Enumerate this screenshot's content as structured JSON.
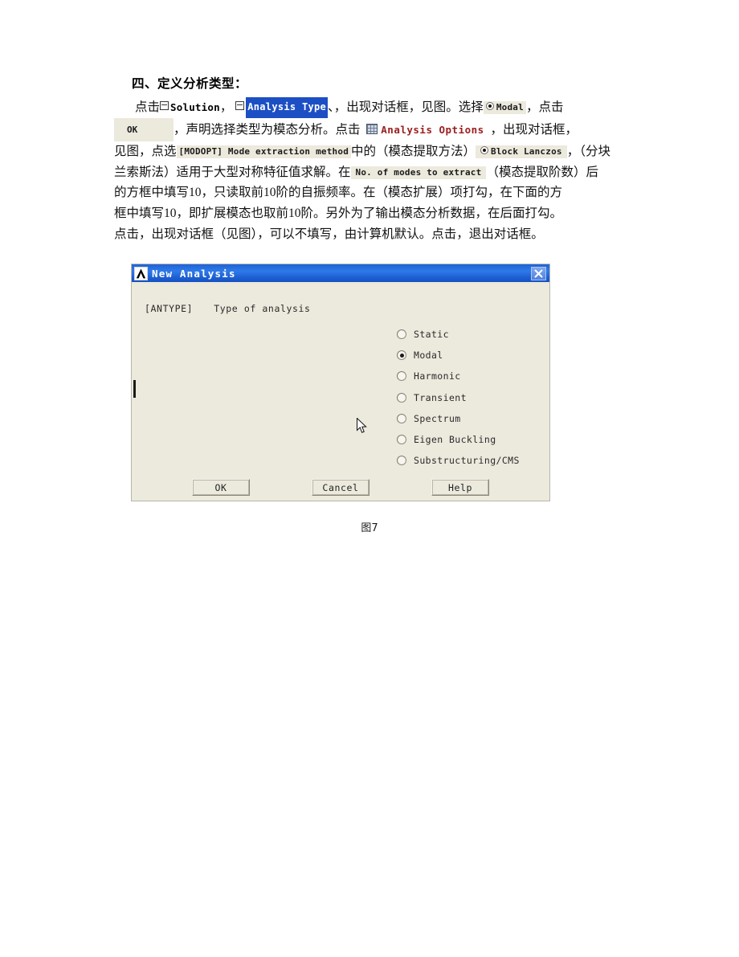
{
  "document": {
    "heading": "四、定义分析类型：",
    "paragraph_lines": [
      "点击⊟ Solution ， ⊟ Analysis Type 、，出现对话框，见图。选择⦿ Modal ，点击",
      "OK ，声明选择类型为模态分析。点击 ▦ Analysis Options ，出现对话框，",
      "见图，点选[MODOPT] Mode extraction method中的（模态提取方法）⦿ Block Lanczos ，（分块",
      "兰索斯法）适用于大型对称特征值求解。在 No. of modes to extract （模态提取阶数）后",
      "的方框中填写10，只读取前10阶的自振频率。在（模态扩展）项打勾，在下面的方",
      "框中填写10，即扩展模态也取前10阶。另外为了输出模态分析数据，在后面打勾。",
      "点击，出现对话框（见图），可以不填写，由计算机默认。点击，退出对话框。"
    ],
    "inline_snippets": {
      "solution": "Solution",
      "analysis_type": "Analysis Type",
      "modal_radio": "Modal",
      "ok_button": "OK",
      "analysis_options": "Analysis Options",
      "modopt": "[MODOPT] Mode extraction method",
      "block_lanczos": "Block Lanczos",
      "no_of_modes": "No. of modes to extract"
    },
    "text_segments": {
      "l1_a": "点击",
      "l1_b": "，",
      "l1_c": "、，出现对话框，见图。选择",
      "l1_d": "，点击",
      "l2_a": "，声明选择类型为模态分析。点击",
      "l2_b": "，出现对话框，",
      "l3_a": "见图，点选",
      "l3_b": "中的（模态提取方法）",
      "l3_c": "，（分块",
      "l4_a": "兰索斯法）适用于大型对称特征值求解。在",
      "l4_b": "（模态提取阶数）后",
      "l5": "的方框中填写10，只读取前10阶的自振频率。在（模态扩展）项打勾，在下面的方",
      "l6": "框中填写10，即扩展模态也取前10阶。另外为了输出模态分析数据，在后面打勾。",
      "l7": "点击，出现对话框（见图），可以不填写，由计算机默认。点击，退出对话框。"
    },
    "figure_caption": "图7"
  },
  "dialog": {
    "title": "New Analysis",
    "logo_icon": "ansys-a-logo-icon",
    "close_icon": "close-icon",
    "field_label_code": "[ANTYPE]",
    "field_label_text": "Type of analysis",
    "options": [
      {
        "label": "Static",
        "selected": false
      },
      {
        "label": "Modal",
        "selected": true
      },
      {
        "label": "Harmonic",
        "selected": false
      },
      {
        "label": "Transient",
        "selected": false
      },
      {
        "label": "Spectrum",
        "selected": false
      },
      {
        "label": "Eigen Buckling",
        "selected": false
      },
      {
        "label": "Substructuring/CMS",
        "selected": false
      }
    ],
    "buttons": {
      "ok": "OK",
      "cancel": "Cancel",
      "help": "Help"
    },
    "colors": {
      "titlebar_blue": "#1f63d8",
      "body_beige": "#ece9dd",
      "highlight_blue": "#1d4fc4",
      "ansys_red": "#9b1d1d"
    }
  }
}
